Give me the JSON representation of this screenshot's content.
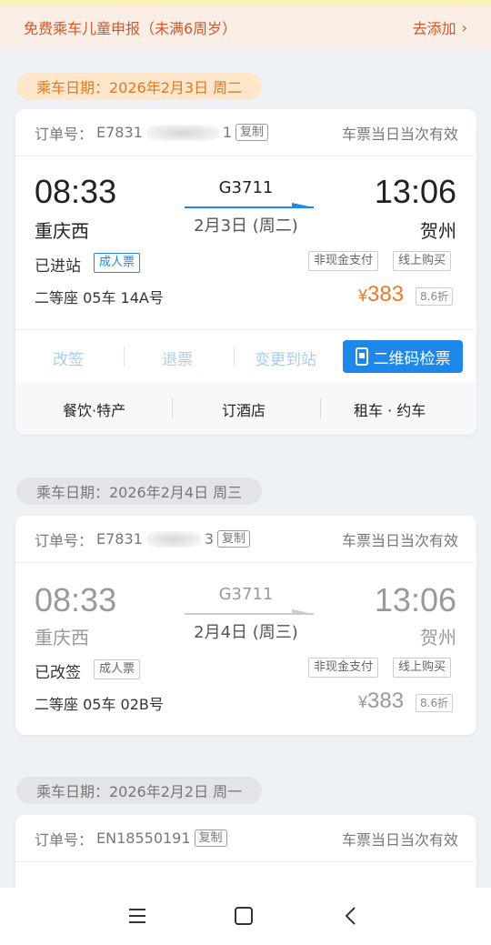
{
  "banner": {
    "text": "免费乘车儿童申报（未满6周岁）",
    "action": "去添加",
    "chevron": "›"
  },
  "tickets": [
    {
      "date": "乘车日期：2026年2月3日 周二",
      "order_label": "订单号：",
      "order_prefix": "E7831",
      "order_suffix": "1",
      "copy": "复制",
      "validity": "车票当日当次有效",
      "depart_time": "08:33",
      "depart_station": "重庆西",
      "train_no": "G3711",
      "travel_date": "2月3日 (周二)",
      "arrive_time": "13:06",
      "arrive_station": "贺州",
      "status": "已进站",
      "ticket_type": "成人票",
      "pay_tag": "非现金支付",
      "buy_tag": "线上购买",
      "seat": "二等座 05车 14A号",
      "price_symbol": "¥",
      "price": "383",
      "discount": "8.6折",
      "actions": [
        "改签",
        "退票",
        "变更到站"
      ],
      "qr_button": "二维码检票",
      "services": [
        "餐饮·特产",
        "订酒店",
        "租车 · 约车"
      ]
    },
    {
      "date": "乘车日期：2026年2月4日 周三",
      "order_label": "订单号：",
      "order_prefix": "E7831",
      "order_suffix": "3",
      "copy": "复制",
      "validity": "车票当日当次有效",
      "depart_time": "08:33",
      "depart_station": "重庆西",
      "train_no": "G3711",
      "travel_date": "2月4日 (周三)",
      "arrive_time": "13:06",
      "arrive_station": "贺州",
      "status": "已改签",
      "ticket_type": "成人票",
      "pay_tag": "非现金支付",
      "buy_tag": "线上购买",
      "seat": "二等座 05车 02B号",
      "price_symbol": "¥",
      "price": "383",
      "discount": "8.6折"
    },
    {
      "date": "乘车日期：2026年2月2日 周一",
      "order_label": "订单号：",
      "order_number": "EN18550191",
      "copy": "复制",
      "validity": "车票当日当次有效"
    }
  ],
  "colors": {
    "accent_blue": "#1e87ea",
    "price_orange": "#ee7a22",
    "banner_text": "#d2582a"
  },
  "navbar": {
    "icons": [
      "menu-icon",
      "home-square-icon",
      "back-chevron-icon"
    ]
  }
}
